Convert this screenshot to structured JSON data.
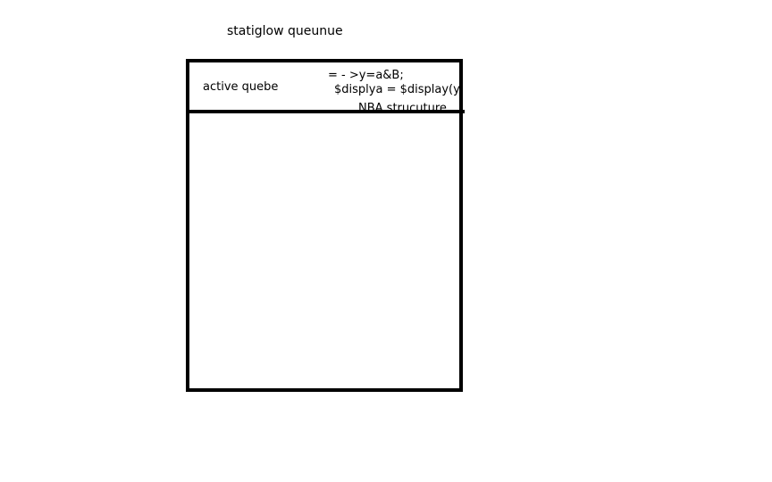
{
  "diagram": {
    "title": "statiglow queunue",
    "header": {
      "left_label": "active quebe",
      "code_line_1": "= - >y=a&B;",
      "code_line_2": "$displya = $display(y);",
      "footer_label": "NBA strucuture"
    }
  }
}
